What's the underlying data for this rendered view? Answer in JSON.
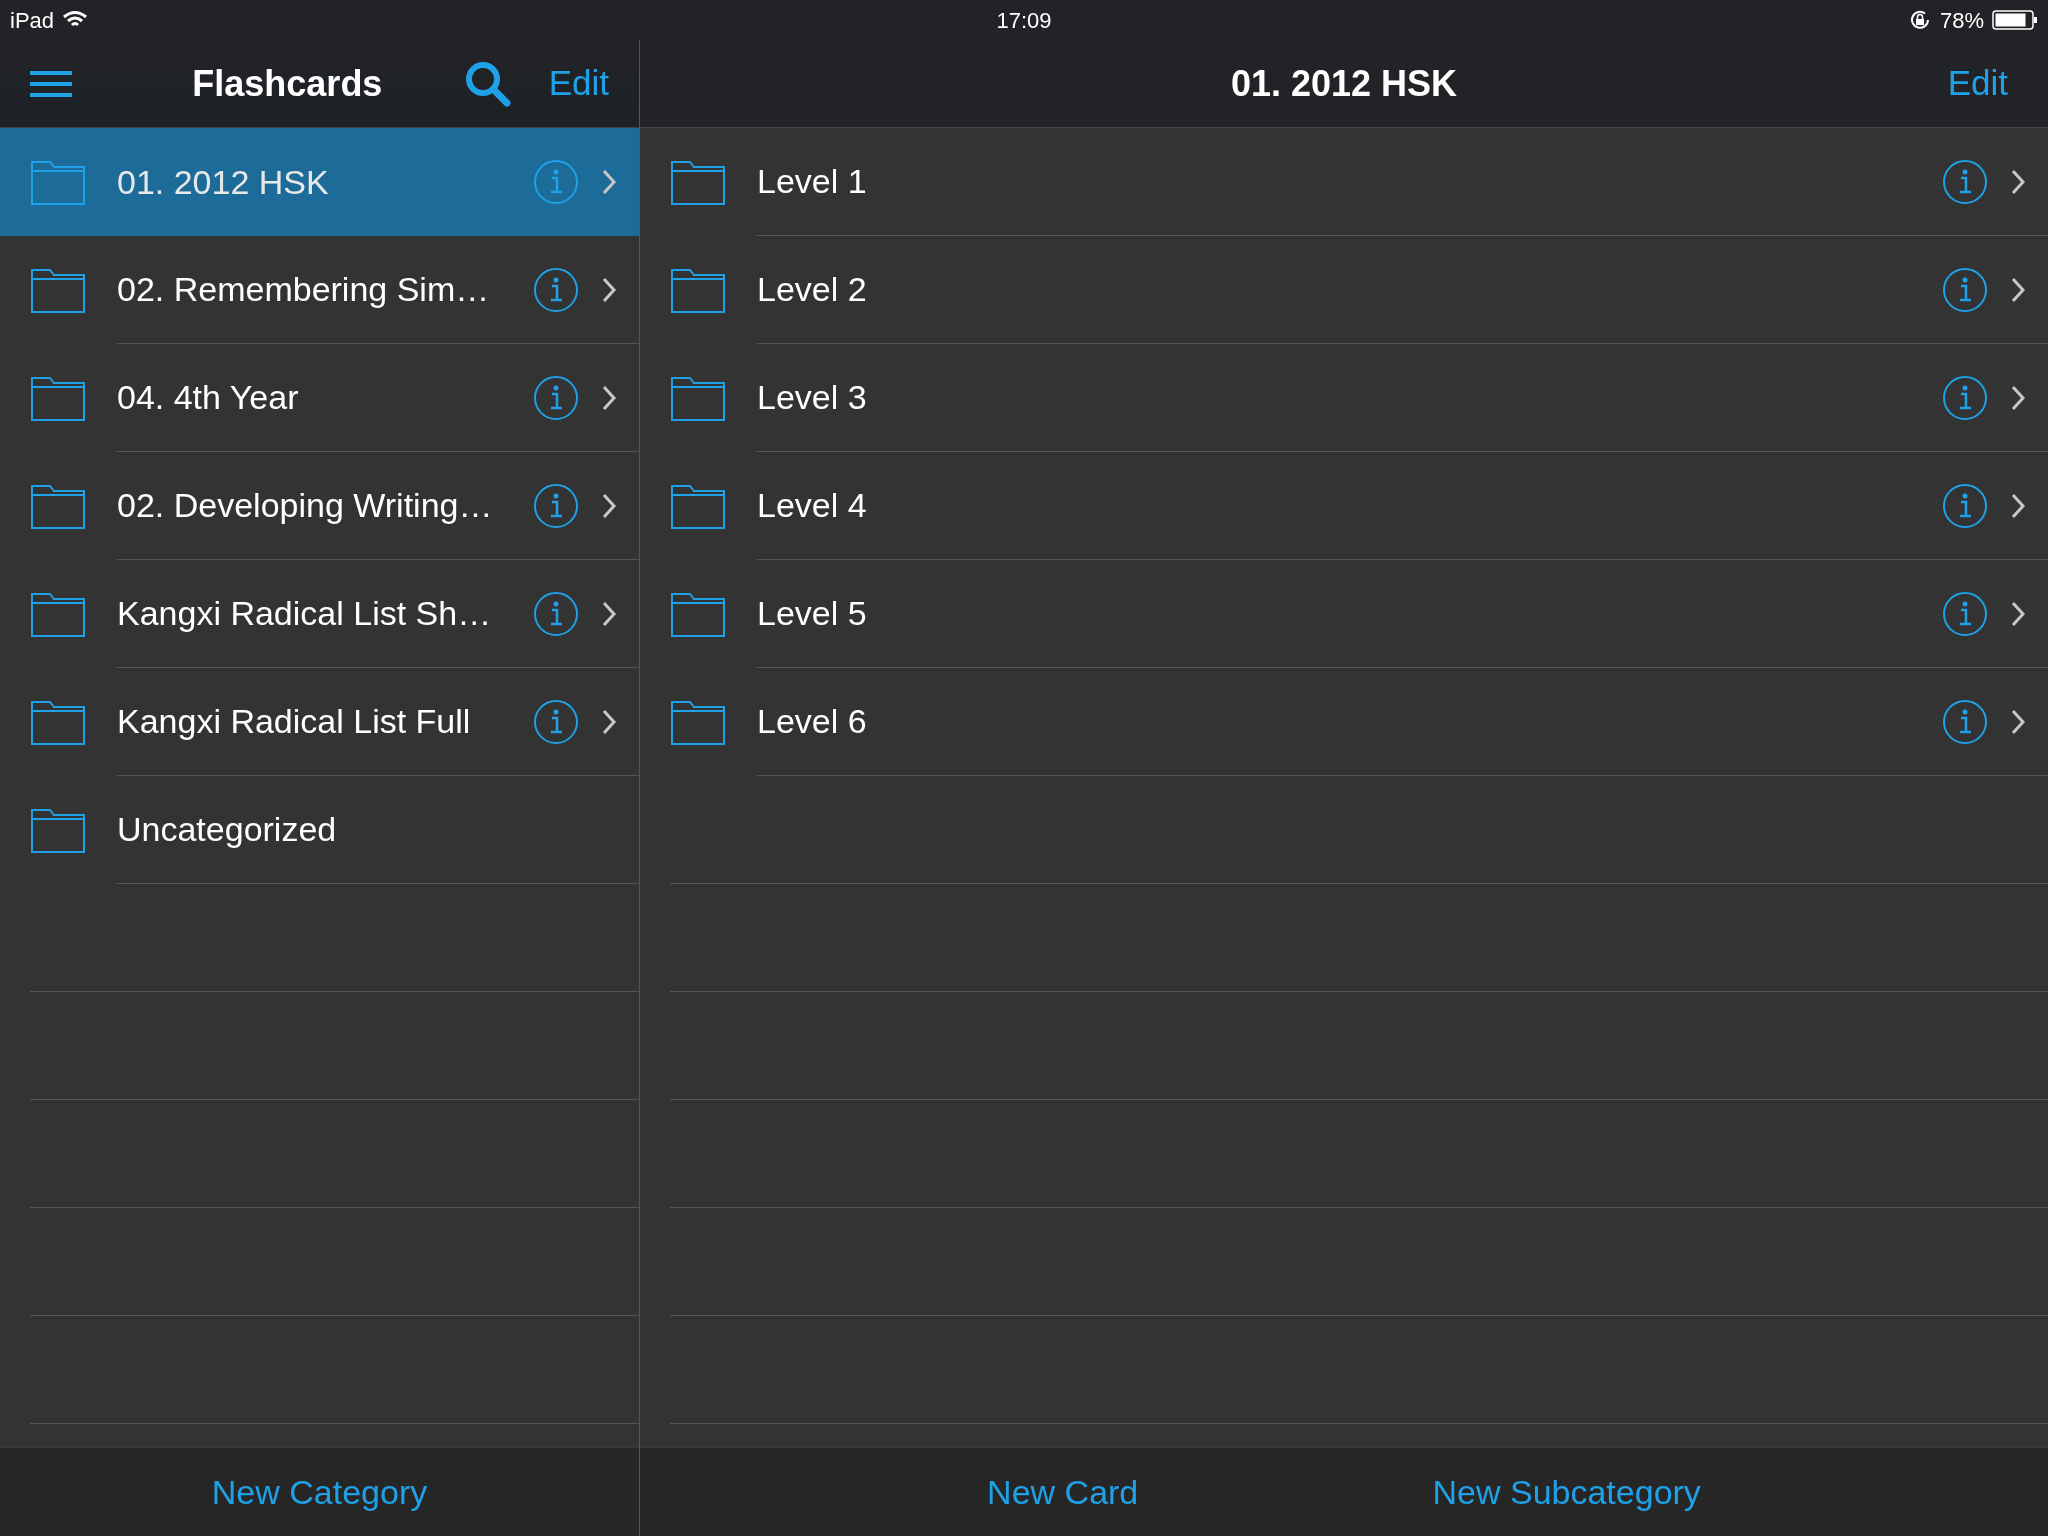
{
  "status_bar": {
    "device": "iPad",
    "time": "17:09",
    "battery": "78%"
  },
  "sidebar": {
    "title": "Flashcards",
    "edit": "Edit",
    "items": [
      {
        "label": "01. 2012 HSK",
        "selected": true,
        "has_detail": true
      },
      {
        "label": "02. Remembering Sim…",
        "selected": false,
        "has_detail": true
      },
      {
        "label": "04. 4th Year",
        "selected": false,
        "has_detail": true
      },
      {
        "label": "02. Developing Writing…",
        "selected": false,
        "has_detail": true
      },
      {
        "label": "Kangxi Radical List Sh…",
        "selected": false,
        "has_detail": true
      },
      {
        "label": "Kangxi Radical List Full",
        "selected": false,
        "has_detail": true
      },
      {
        "label": "Uncategorized",
        "selected": false,
        "has_detail": false
      }
    ],
    "toolbar": [
      "New Category"
    ]
  },
  "detail": {
    "title": "01. 2012 HSK",
    "edit": "Edit",
    "items": [
      {
        "label": "Level 1",
        "selected": false,
        "has_detail": true
      },
      {
        "label": "Level 2",
        "selected": false,
        "has_detail": true
      },
      {
        "label": "Level 3",
        "selected": false,
        "has_detail": true
      },
      {
        "label": "Level 4",
        "selected": false,
        "has_detail": true
      },
      {
        "label": "Level 5",
        "selected": false,
        "has_detail": true
      },
      {
        "label": "Level 6",
        "selected": false,
        "has_detail": true
      }
    ],
    "toolbar": [
      "New Card",
      "New Subcategory"
    ]
  }
}
